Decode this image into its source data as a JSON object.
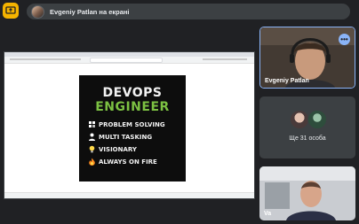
{
  "header": {
    "presenting_text": "Evgeniy Patlan на екрані",
    "present_icon": "present-to-all-icon",
    "accent": "#f5b400"
  },
  "presentation": {
    "poster": {
      "title_line1": "DEVOPS",
      "title_line2": "ENGINEER",
      "items": [
        {
          "icon": "puzzle-icon",
          "label": "PROBLEM SOLVING"
        },
        {
          "icon": "person-icon",
          "label": "MULTI TASKING"
        },
        {
          "icon": "lightbulb-icon",
          "label": "VISIONARY"
        },
        {
          "icon": "fire-icon",
          "label": "ALWAYS ON FIRE"
        }
      ],
      "accent_color": "#7cc142"
    }
  },
  "participants": {
    "main_tile_name": "Evgeniy Patlan",
    "more_label": "Ще 31 особа",
    "bottom_tile_name": "Va",
    "active_border": "#8ab4f8"
  }
}
